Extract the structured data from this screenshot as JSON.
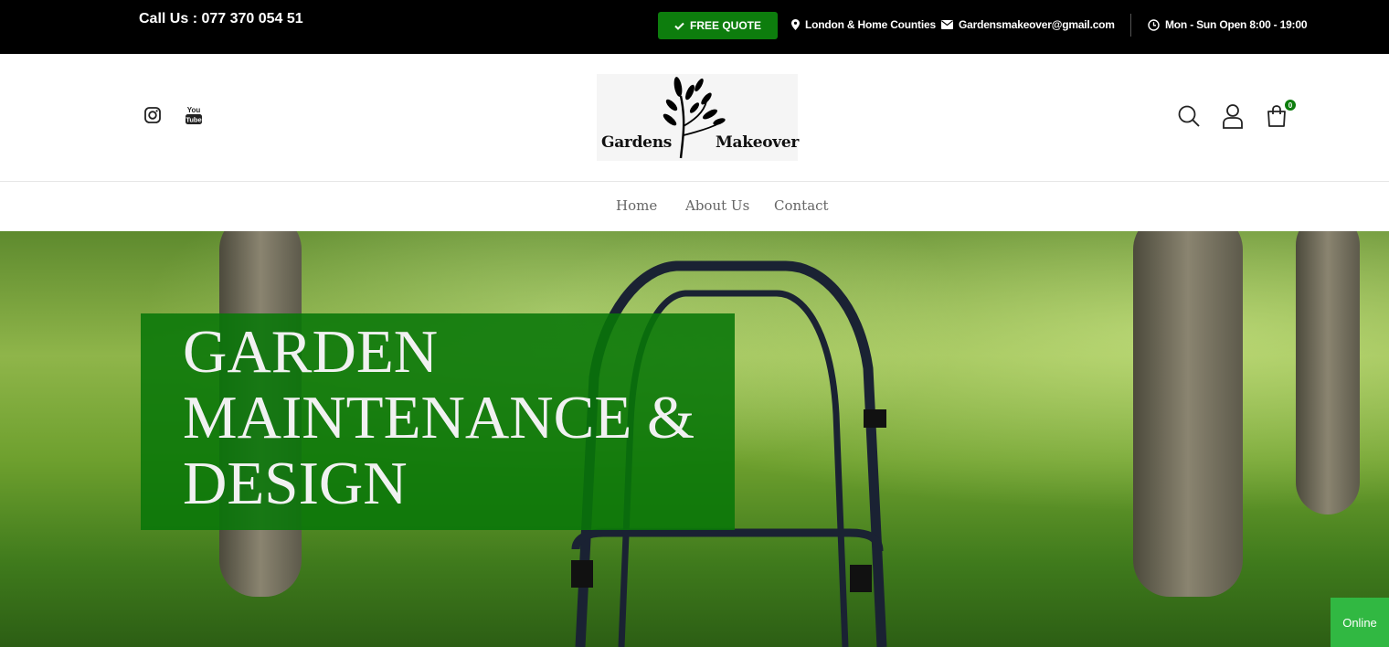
{
  "topbar": {
    "call": "Call  Us : 077 370 054 51",
    "quote_label": "FREE QUOTE",
    "location": "London & Home Counties",
    "email": "Gardensmakeover@gmail.com",
    "hours": "Mon - Sun Open 8:00 - 19:00"
  },
  "header": {
    "social_icons": [
      "instagram-icon",
      "youtube-icon"
    ],
    "youtube_text": "You Tube",
    "logo": {
      "left_word": "Gardens",
      "right_word": "Makeover"
    },
    "cart_count": "0"
  },
  "nav": {
    "items": [
      "Home",
      "About Us",
      "Contact"
    ]
  },
  "hero": {
    "line1": "GARDEN",
    "line2": "MAINTENANCE &",
    "line3": "DESIGN"
  },
  "chat": {
    "status": "Online"
  },
  "colors": {
    "brand_green": "#0d7d0d",
    "topbar_bg": "#000000",
    "online_green": "#31b842"
  }
}
